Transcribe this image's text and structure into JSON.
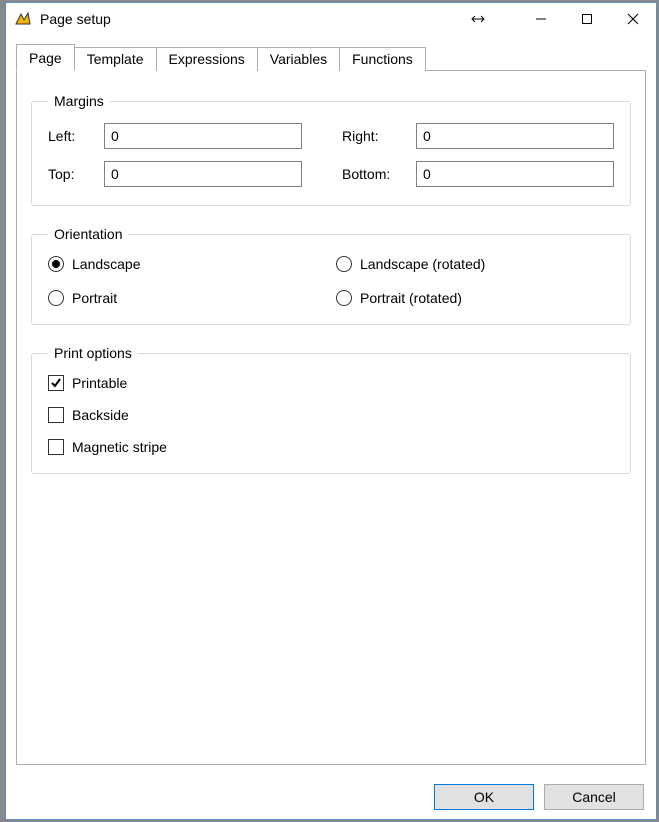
{
  "window": {
    "title": "Page setup"
  },
  "tabs": [
    {
      "label": "Page"
    },
    {
      "label": "Template"
    },
    {
      "label": "Expressions"
    },
    {
      "label": "Variables"
    },
    {
      "label": "Functions"
    }
  ],
  "groups": {
    "margins": {
      "legend": "Margins",
      "left_label": "Left:",
      "right_label": "Right:",
      "top_label": "Top:",
      "bottom_label": "Bottom:",
      "left": "0",
      "right": "0",
      "top": "0",
      "bottom": "0"
    },
    "orientation": {
      "legend": "Orientation",
      "landscape": "Landscape",
      "landscape_rotated": "Landscape (rotated)",
      "portrait": "Portrait",
      "portrait_rotated": "Portrait (rotated)",
      "selected": "landscape"
    },
    "print_options": {
      "legend": "Print options",
      "printable": "Printable",
      "backside": "Backside",
      "magnetic_stripe": "Magnetic stripe",
      "printable_checked": true,
      "backside_checked": false,
      "magnetic_stripe_checked": false
    }
  },
  "footer": {
    "ok": "OK",
    "cancel": "Cancel"
  }
}
